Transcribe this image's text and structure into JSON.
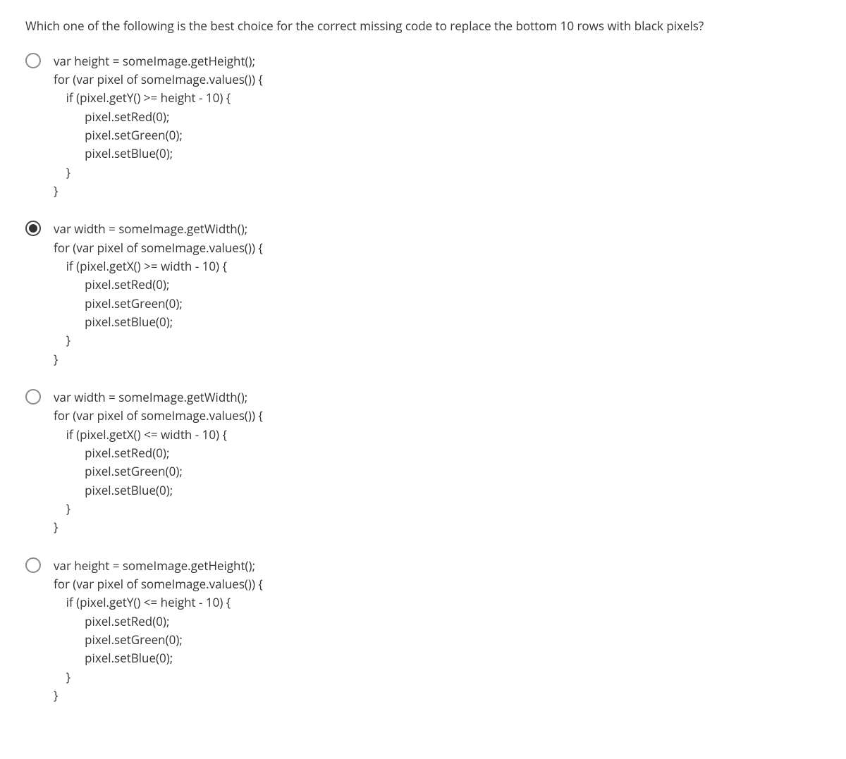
{
  "questionText": "Which one of the following is the best choice for the correct missing code to replace the bottom 10 rows with black pixels?",
  "options": [
    {
      "selected": false,
      "code": "var height = someImage.getHeight();\nfor (var pixel of someImage.values()) {\n    if (pixel.getY() >= height - 10) {\n          pixel.setRed(0);\n          pixel.setGreen(0);\n          pixel.setBlue(0);\n    }\n}"
    },
    {
      "selected": true,
      "code": "var width = someImage.getWidth();\nfor (var pixel of someImage.values()) {\n    if (pixel.getX() >= width - 10) {\n          pixel.setRed(0);\n          pixel.setGreen(0);\n          pixel.setBlue(0);\n    }\n}"
    },
    {
      "selected": false,
      "code": "var width = someImage.getWidth();\nfor (var pixel of someImage.values()) {\n    if (pixel.getX() <= width - 10) {\n          pixel.setRed(0);\n          pixel.setGreen(0);\n          pixel.setBlue(0);\n    }\n}"
    },
    {
      "selected": false,
      "code": "var height = someImage.getHeight();\nfor (var pixel of someImage.values()) {\n    if (pixel.getY() <= height - 10) {\n          pixel.setRed(0);\n          pixel.setGreen(0);\n          pixel.setBlue(0);\n    }\n}"
    }
  ]
}
